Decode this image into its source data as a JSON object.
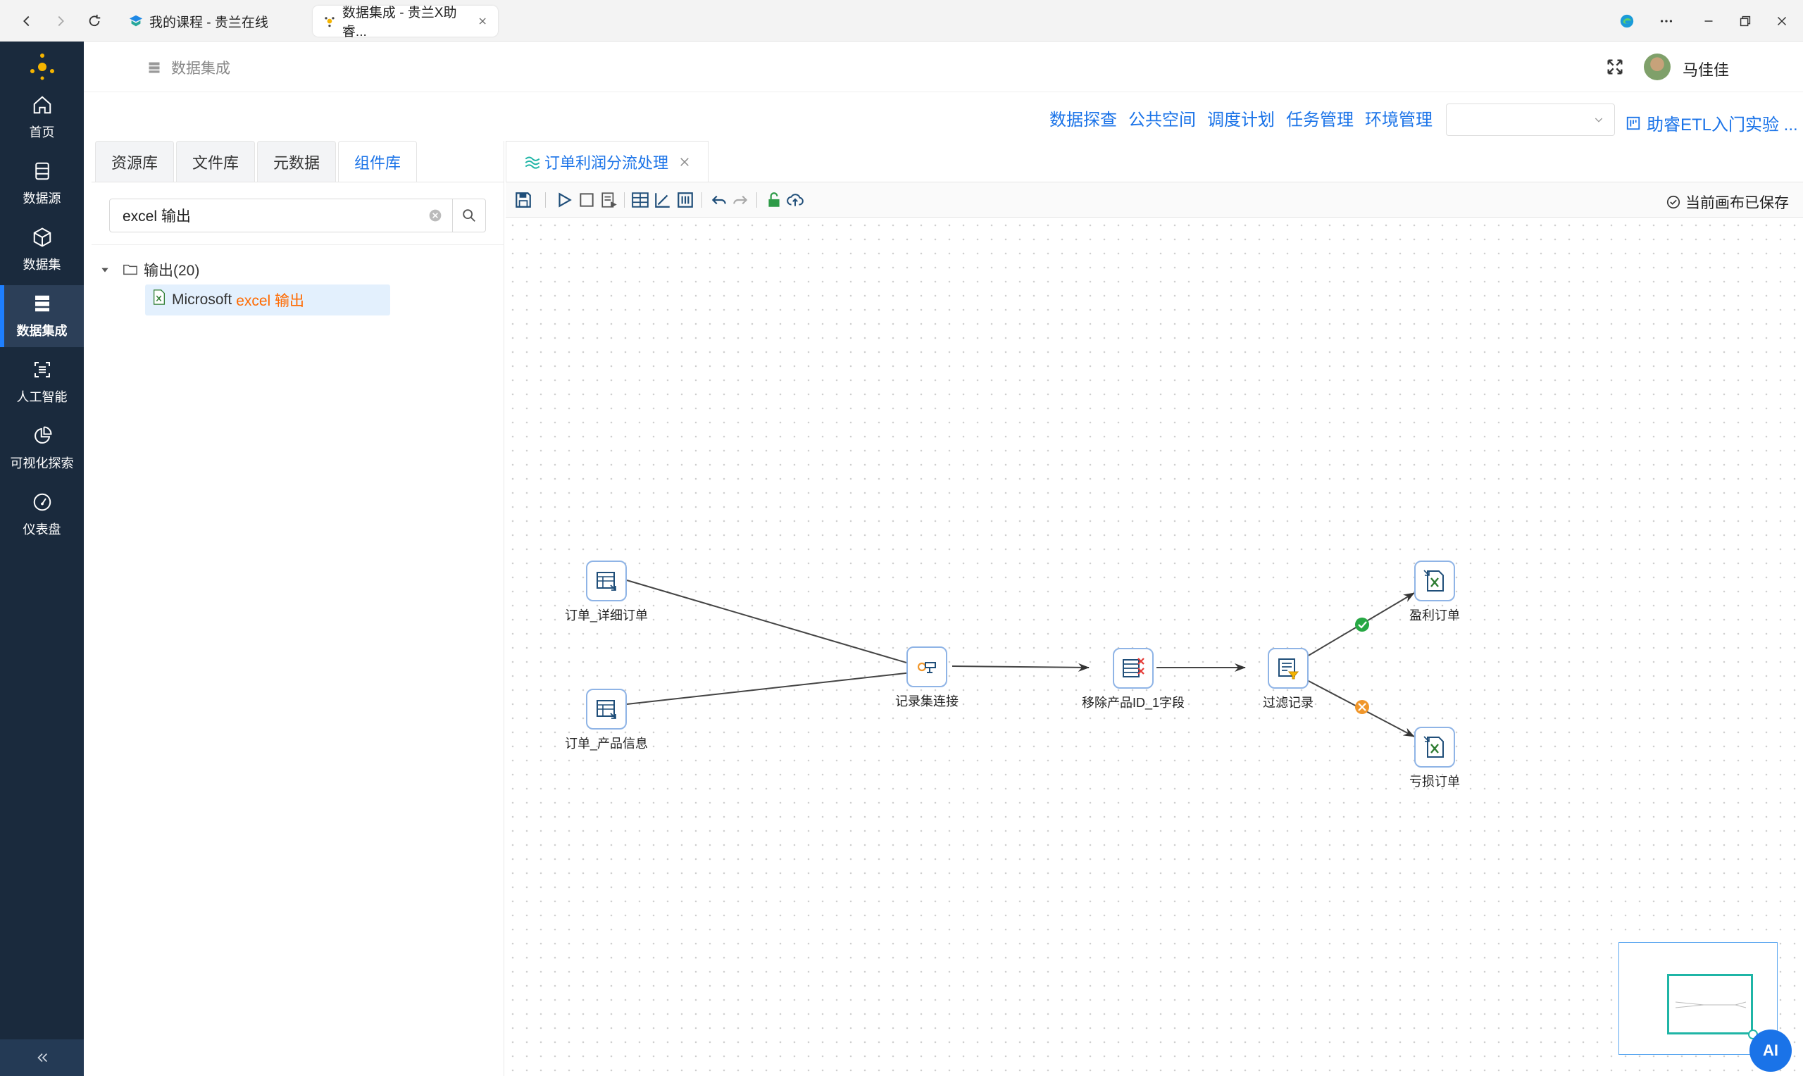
{
  "browser": {
    "tabs": [
      {
        "title": "我的课程 - 贵兰在线",
        "active": false
      },
      {
        "title": "数据集成 - 贵兰X助睿...",
        "active": true
      }
    ]
  },
  "sidebar": {
    "items": [
      {
        "label": "首页",
        "icon": "home-icon"
      },
      {
        "label": "数据源",
        "icon": "database-icon"
      },
      {
        "label": "数据集",
        "icon": "cube-icon"
      },
      {
        "label": "数据集成",
        "icon": "server-icon",
        "active": true
      },
      {
        "label": "人工智能",
        "icon": "ai-icon"
      },
      {
        "label": "可视化探索",
        "icon": "pie-chart-icon"
      },
      {
        "label": "仪表盘",
        "icon": "gauge-icon"
      }
    ],
    "active_color": "#1e7fff",
    "bg_color": "#1a2a3d"
  },
  "header": {
    "title": "数据集成",
    "user": "马佳佳"
  },
  "topmenu": {
    "items": [
      "数据探查",
      "公共空间",
      "调度计划",
      "任务管理",
      "环境管理"
    ],
    "env_select_value": "",
    "project": "助睿ETL入门实验 ..."
  },
  "left_panel": {
    "tabs": [
      "资源库",
      "文件库",
      "元数据",
      "组件库"
    ],
    "active_tab": "组件库",
    "search_value": "excel 输出",
    "tree": {
      "folder": "输出(20)",
      "leaf_prefix": "Microsoft",
      "leaf_highlight": "excel 输出"
    }
  },
  "editor": {
    "tab_title": "订单利润分流处理",
    "saved_status": "当前画布已保存"
  },
  "flow": {
    "nodes": [
      {
        "id": "n1",
        "label": "订单_详细订单",
        "icon": "table-input-icon"
      },
      {
        "id": "n2",
        "label": "订单_产品信息",
        "icon": "table-input-icon"
      },
      {
        "id": "n3",
        "label": "记录集连接",
        "icon": "join-icon"
      },
      {
        "id": "n4",
        "label": "移除产品ID_1字段",
        "icon": "remove-field-icon"
      },
      {
        "id": "n5",
        "label": "过滤记录",
        "icon": "filter-icon"
      },
      {
        "id": "n6",
        "label": "盈利订单",
        "icon": "excel-output-icon"
      },
      {
        "id": "n7",
        "label": "亏损订单",
        "icon": "excel-output-icon"
      }
    ],
    "edges": [
      {
        "from": "n1",
        "to": "n3"
      },
      {
        "from": "n2",
        "to": "n3"
      },
      {
        "from": "n3",
        "to": "n4"
      },
      {
        "from": "n4",
        "to": "n5"
      },
      {
        "from": "n5",
        "to": "n6",
        "status": "true"
      },
      {
        "from": "n5",
        "to": "n7",
        "status": "false"
      }
    ]
  },
  "ai_button": "AI"
}
